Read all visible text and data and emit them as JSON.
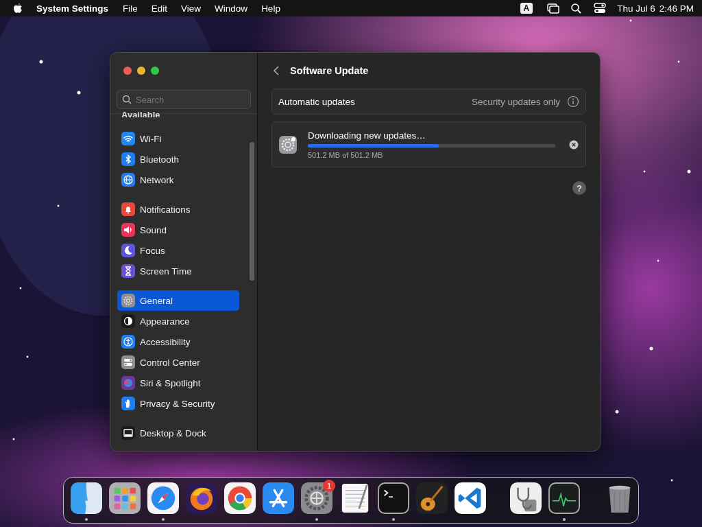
{
  "menu_bar": {
    "app_name": "System Settings",
    "menus": [
      "File",
      "Edit",
      "View",
      "Window",
      "Help"
    ],
    "input_source": "A",
    "date": "Thu Jul 6",
    "time": "2:46 PM"
  },
  "window": {
    "search": {
      "placeholder": "Search"
    },
    "sidebar": {
      "cut_heading": "Available",
      "sections": [
        {
          "items": [
            {
              "label": "Wi-Fi",
              "color": "#1e88f0",
              "selected": false
            },
            {
              "label": "Bluetooth",
              "color": "#1e7ef0",
              "selected": false
            },
            {
              "label": "Network",
              "color": "#2a7ce8",
              "selected": false
            }
          ]
        },
        {
          "items": [
            {
              "label": "Notifications",
              "color": "#e8473e",
              "selected": false
            },
            {
              "label": "Sound",
              "color": "#e8365a",
              "selected": false
            },
            {
              "label": "Focus",
              "color": "#5e55d6",
              "selected": false
            },
            {
              "label": "Screen Time",
              "color": "#6a50d0",
              "selected": false
            }
          ]
        },
        {
          "items": [
            {
              "label": "General",
              "color": "#8e8e93",
              "selected": true
            },
            {
              "label": "Appearance",
              "color": "#1c1c1e",
              "selected": false
            },
            {
              "label": "Accessibility",
              "color": "#1e7ef0",
              "selected": false
            },
            {
              "label": "Control Center",
              "color": "#8e8e93",
              "selected": false
            },
            {
              "label": "Siri & Spotlight",
              "color": "#6a3a9a",
              "selected": false
            },
            {
              "label": "Privacy & Security",
              "color": "#1e7ef0",
              "selected": false
            }
          ]
        },
        {
          "items": [
            {
              "label": "Desktop & Dock",
              "color": "#1c1c1e",
              "selected": false
            }
          ]
        }
      ]
    },
    "content": {
      "title": "Software Update",
      "automatic_updates": {
        "label": "Automatic updates",
        "value": "Security updates only"
      },
      "help": "?",
      "download": {
        "status": "Downloading new updates…",
        "level": 0.53,
        "size": "501.2 MB of 501.2 MB"
      }
    }
  },
  "dock": {
    "groups": [
      [
        {
          "running": true
        },
        {
          "running": false
        },
        {
          "running": true
        },
        {
          "running": false
        },
        {
          "running": false
        },
        {
          "running": false
        },
        {
          "running": true,
          "badge": "1"
        },
        {
          "running": false
        },
        {
          "running": true
        },
        {
          "running": false
        },
        {
          "running": false
        }
      ],
      [
        {
          "running": false
        },
        {
          "running": true
        }
      ],
      [
        {
          "running": false
        }
      ]
    ]
  }
}
